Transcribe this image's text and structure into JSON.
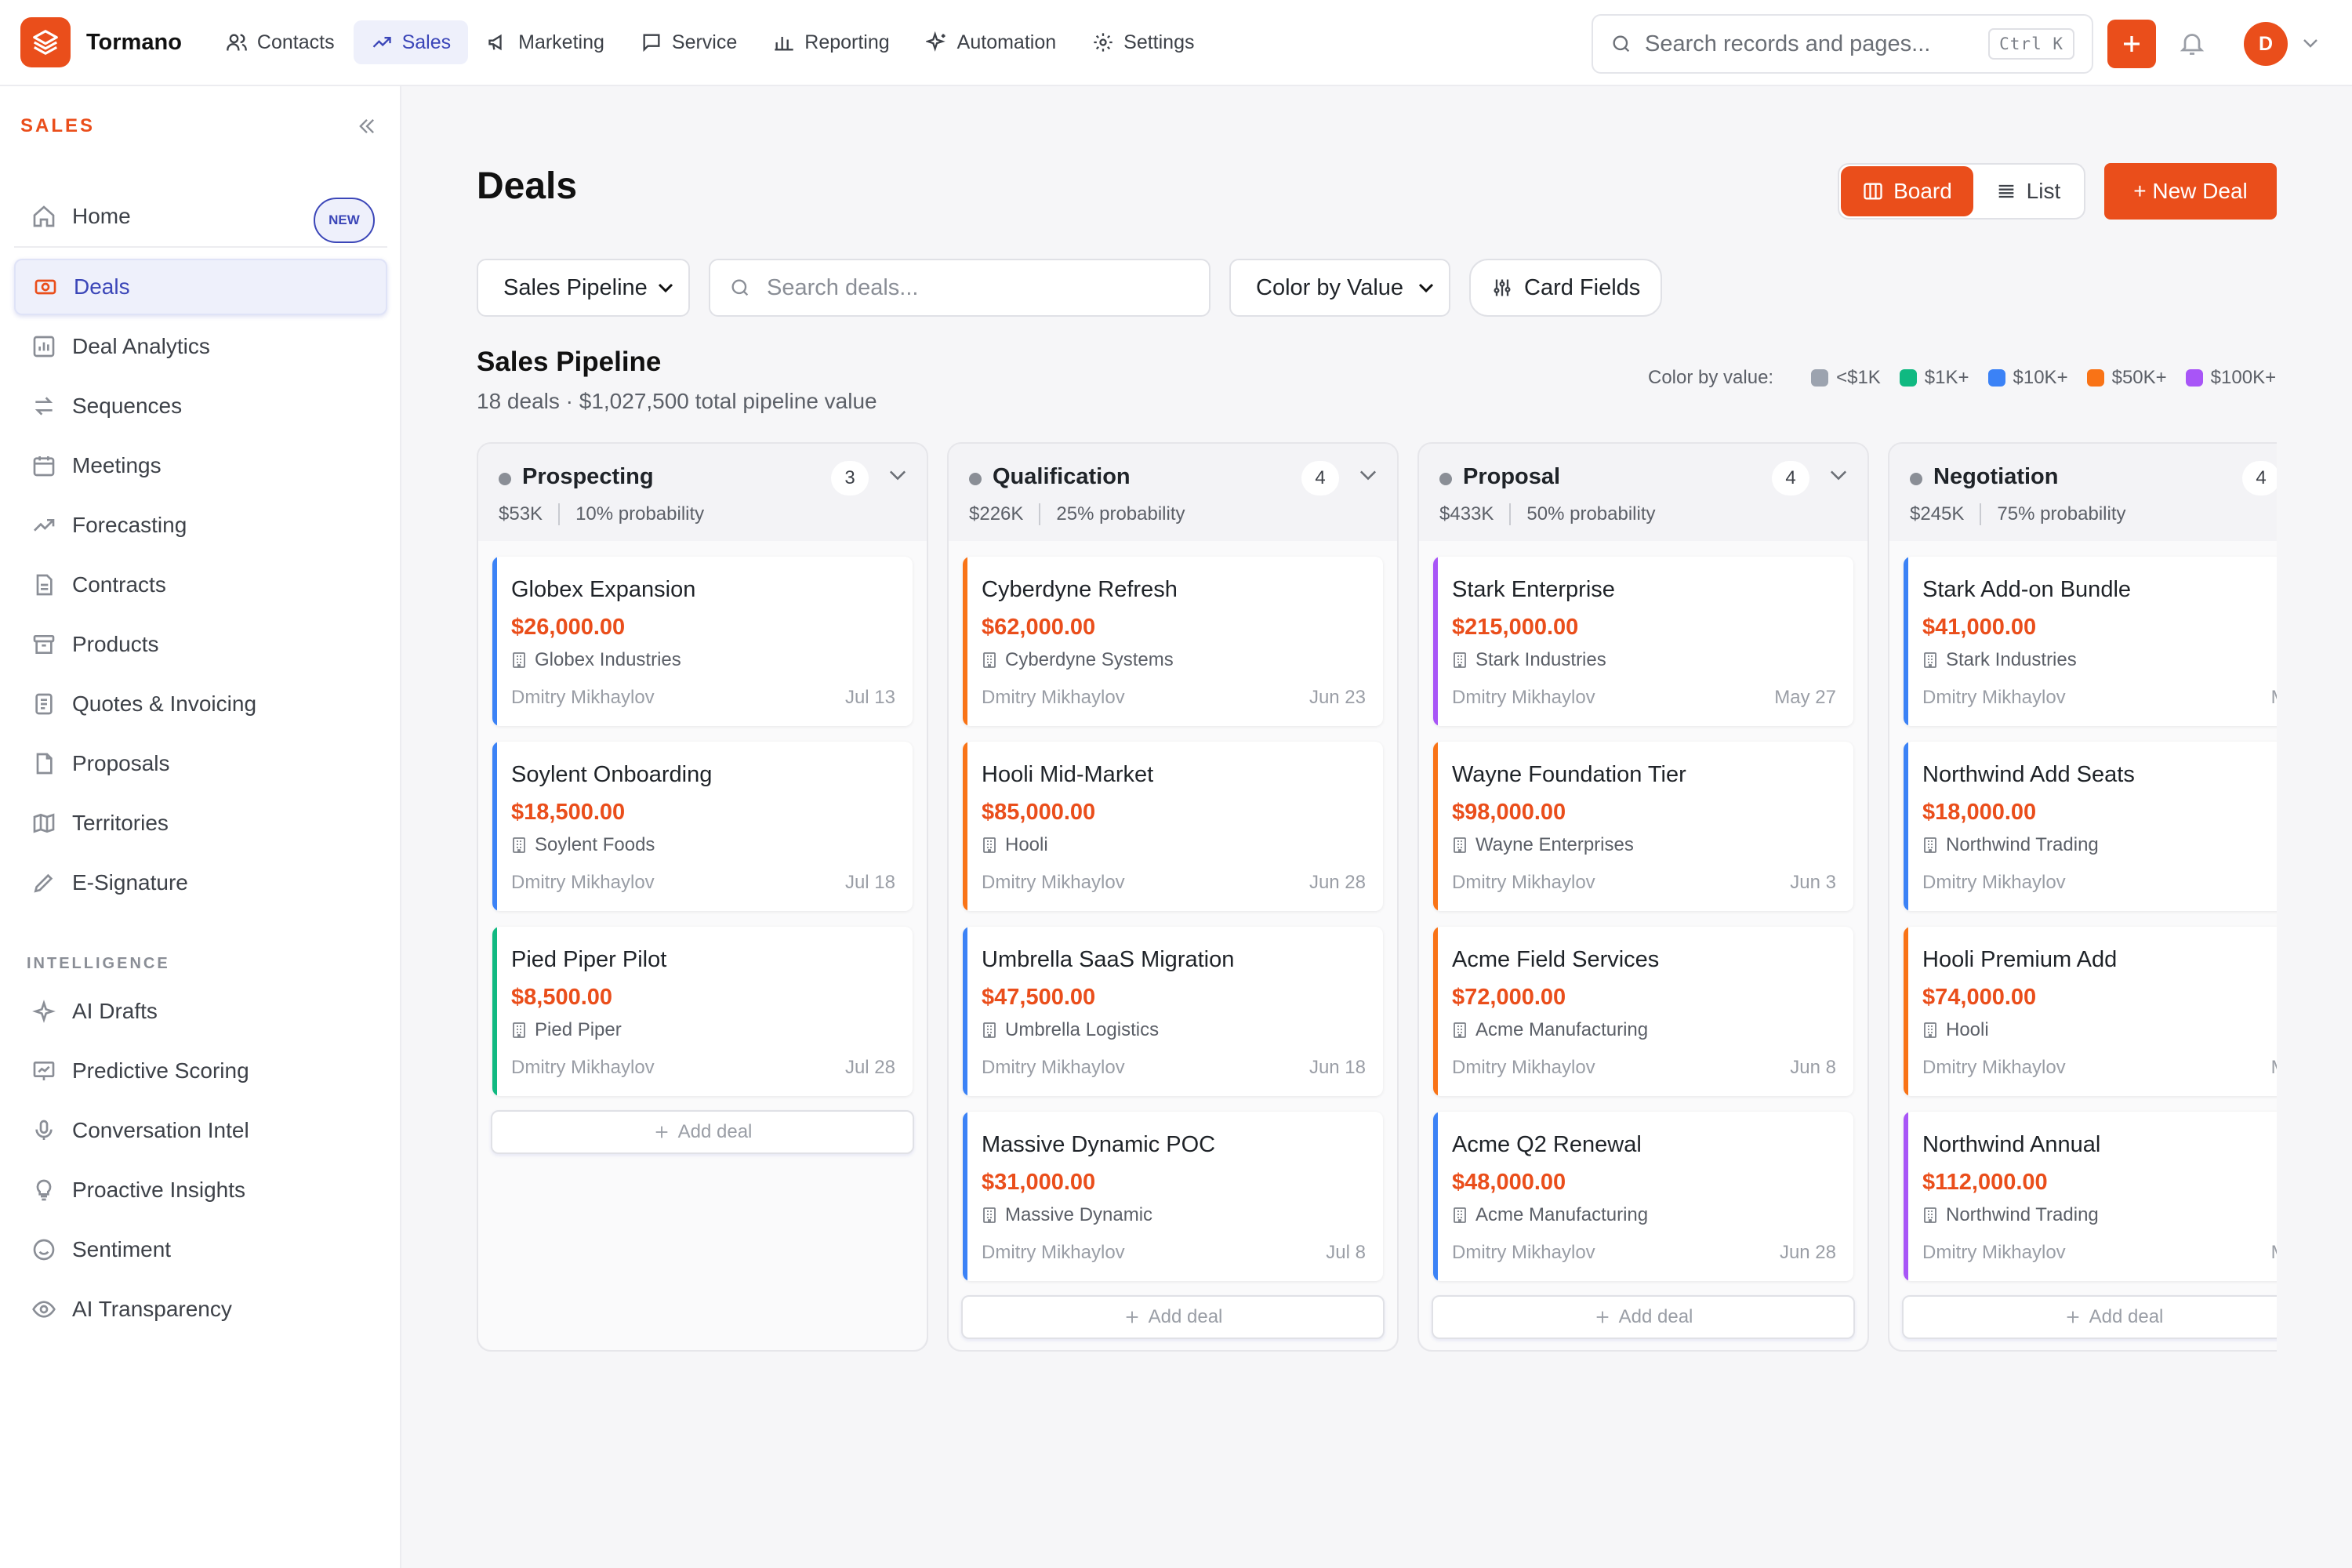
{
  "app": {
    "name": "Tormano",
    "brand_color": "#ea4e1b",
    "accent_color": "#3b46b8"
  },
  "nav": {
    "items": [
      {
        "label": "Contacts",
        "icon": "users-icon"
      },
      {
        "label": "Sales",
        "icon": "trending-up-icon",
        "active": true
      },
      {
        "label": "Marketing",
        "icon": "megaphone-icon"
      },
      {
        "label": "Service",
        "icon": "chat-icon"
      },
      {
        "label": "Reporting",
        "icon": "bar-chart-icon"
      },
      {
        "label": "Automation",
        "icon": "sparkles-icon"
      },
      {
        "label": "Settings",
        "icon": "gear-icon"
      }
    ],
    "search_placeholder": "Search records and pages...",
    "search_shortcut": "Ctrl K",
    "avatar_initial": "D"
  },
  "sidebar": {
    "title": "SALES",
    "home": {
      "label": "Home",
      "badge": "NEW"
    },
    "items": [
      {
        "label": "Deals",
        "icon": "deals-icon",
        "active": true
      },
      {
        "label": "Deal Analytics",
        "icon": "analytics-icon"
      },
      {
        "label": "Sequences",
        "icon": "arrows-icon"
      },
      {
        "label": "Meetings",
        "icon": "calendar-icon"
      },
      {
        "label": "Forecasting",
        "icon": "trending-up-icon"
      },
      {
        "label": "Contracts",
        "icon": "document-icon"
      },
      {
        "label": "Products",
        "icon": "box-icon"
      },
      {
        "label": "Quotes & Invoicing",
        "icon": "receipt-icon"
      },
      {
        "label": "Proposals",
        "icon": "file-icon"
      },
      {
        "label": "Territories",
        "icon": "map-icon"
      },
      {
        "label": "E-Signature",
        "icon": "pen-icon"
      }
    ],
    "intelligence_title": "INTELLIGENCE",
    "intelligence_items": [
      {
        "label": "AI Drafts",
        "icon": "sparkle-icon"
      },
      {
        "label": "Predictive Scoring",
        "icon": "presentation-icon"
      },
      {
        "label": "Conversation Intel",
        "icon": "microphone-icon"
      },
      {
        "label": "Proactive Insights",
        "icon": "lightbulb-icon"
      },
      {
        "label": "Sentiment",
        "icon": "smile-icon"
      },
      {
        "label": "AI Transparency",
        "icon": "eye-icon"
      }
    ]
  },
  "page": {
    "title": "Deals",
    "view_board": "Board",
    "view_list": "List",
    "new_deal": "+ New Deal",
    "pipeline_select": "Sales Pipeline",
    "search_placeholder": "Search deals...",
    "color_select": "Color by Value",
    "card_fields": "Card Fields",
    "pipeline_title": "Sales Pipeline",
    "pipeline_summary": "18 deals · $1,027,500 total pipeline value",
    "legend_title": "Color by value:",
    "legend": [
      {
        "label": "<$1K",
        "color": "#9ca3af"
      },
      {
        "label": "$1K+",
        "color": "#10b981"
      },
      {
        "label": "$10K+",
        "color": "#3b82f6"
      },
      {
        "label": "$50K+",
        "color": "#f97316"
      },
      {
        "label": "$100K+",
        "color": "#a855f7"
      }
    ],
    "add_deal": "Add deal"
  },
  "columns": [
    {
      "name": "Prospecting",
      "count": "3",
      "value": "$53K",
      "probability": "10% probability",
      "deals": [
        {
          "title": "Globex Expansion",
          "amount": "$26,000.00",
          "company": "Globex Industries",
          "owner": "Dmitry Mikhaylov",
          "date": "Jul 13",
          "color": "#3b82f6"
        },
        {
          "title": "Soylent Onboarding",
          "amount": "$18,500.00",
          "company": "Soylent Foods",
          "owner": "Dmitry Mikhaylov",
          "date": "Jul 18",
          "color": "#3b82f6"
        },
        {
          "title": "Pied Piper Pilot",
          "amount": "$8,500.00",
          "company": "Pied Piper",
          "owner": "Dmitry Mikhaylov",
          "date": "Jul 28",
          "color": "#10b981"
        }
      ]
    },
    {
      "name": "Qualification",
      "count": "4",
      "value": "$226K",
      "probability": "25% probability",
      "deals": [
        {
          "title": "Cyberdyne Refresh",
          "amount": "$62,000.00",
          "company": "Cyberdyne Systems",
          "owner": "Dmitry Mikhaylov",
          "date": "Jun 23",
          "color": "#f97316"
        },
        {
          "title": "Hooli Mid-Market",
          "amount": "$85,000.00",
          "company": "Hooli",
          "owner": "Dmitry Mikhaylov",
          "date": "Jun 28",
          "color": "#f97316"
        },
        {
          "title": "Umbrella SaaS Migration",
          "amount": "$47,500.00",
          "company": "Umbrella Logistics",
          "owner": "Dmitry Mikhaylov",
          "date": "Jun 18",
          "color": "#3b82f6"
        },
        {
          "title": "Massive Dynamic POC",
          "amount": "$31,000.00",
          "company": "Massive Dynamic",
          "owner": "Dmitry Mikhaylov",
          "date": "Jul 8",
          "color": "#3b82f6"
        }
      ]
    },
    {
      "name": "Proposal",
      "count": "4",
      "value": "$433K",
      "probability": "50% probability",
      "deals": [
        {
          "title": "Stark Enterprise",
          "amount": "$215,000.00",
          "company": "Stark Industries",
          "owner": "Dmitry Mikhaylov",
          "date": "May 27",
          "color": "#a855f7"
        },
        {
          "title": "Wayne Foundation Tier",
          "amount": "$98,000.00",
          "company": "Wayne Enterprises",
          "owner": "Dmitry Mikhaylov",
          "date": "Jun 3",
          "color": "#f97316"
        },
        {
          "title": "Acme Field Services",
          "amount": "$72,000.00",
          "company": "Acme Manufacturing",
          "owner": "Dmitry Mikhaylov",
          "date": "Jun 8",
          "color": "#f97316"
        },
        {
          "title": "Acme Q2 Renewal",
          "amount": "$48,000.00",
          "company": "Acme Manufacturing",
          "owner": "Dmitry Mikhaylov",
          "date": "Jun 28",
          "color": "#3b82f6"
        }
      ]
    },
    {
      "name": "Negotiation",
      "count": "4",
      "value": "$245K",
      "probability": "75% probability",
      "deals": [
        {
          "title": "Stark Add-on Bundle",
          "amount": "$41,000.00",
          "company": "Stark Industries",
          "owner": "Dmitry Mikhaylov",
          "date": "May",
          "color": "#3b82f6"
        },
        {
          "title": "Northwind Add Seats",
          "amount": "$18,000.00",
          "company": "Northwind Trading",
          "owner": "Dmitry Mikhaylov",
          "date": "Ma",
          "color": "#3b82f6"
        },
        {
          "title": "Hooli Premium Add",
          "amount": "$74,000.00",
          "company": "Hooli",
          "owner": "Dmitry Mikhaylov",
          "date": "May",
          "color": "#f97316"
        },
        {
          "title": "Northwind Annual",
          "amount": "$112,000.00",
          "company": "Northwind Trading",
          "owner": "Dmitry Mikhaylov",
          "date": "May",
          "color": "#a855f7"
        }
      ]
    }
  ]
}
